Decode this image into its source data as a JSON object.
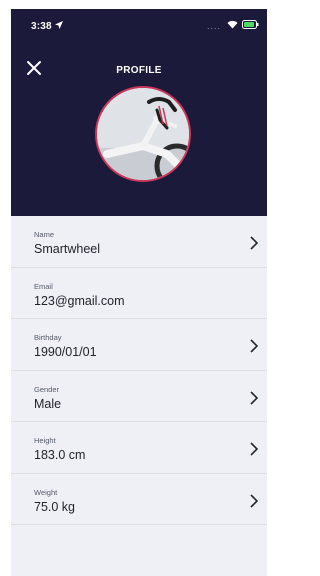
{
  "status": {
    "time": "3:38"
  },
  "header": {
    "title": "PROFILE"
  },
  "fields": [
    {
      "label": "Name",
      "value": "Smartwheel",
      "has_chevron": true
    },
    {
      "label": "Email",
      "value": "123@gmail.com",
      "has_chevron": false
    },
    {
      "label": "Birthday",
      "value": "1990/01/01",
      "has_chevron": true
    },
    {
      "label": "Gender",
      "value": "Male",
      "has_chevron": true
    },
    {
      "label": "Height",
      "value": "183.0 cm",
      "has_chevron": true
    },
    {
      "label": "Weight",
      "value": "75.0 kg",
      "has_chevron": true
    }
  ],
  "colors": {
    "header_bg": "#1c1a3a",
    "avatar_ring": "#c8365a",
    "battery": "#4cd964",
    "list_bg": "#eef0f6"
  },
  "icons": {
    "close": "close-icon",
    "chevron": "chevron-right-icon",
    "location": "location-arrow-icon",
    "wifi": "wifi-icon",
    "battery": "battery-icon"
  }
}
